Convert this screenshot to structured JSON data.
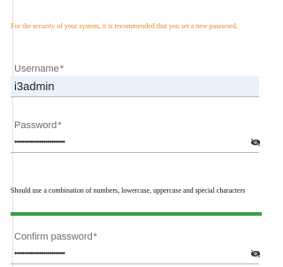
{
  "notice": "For the security of your system, it is recommended that you set a new password.",
  "fields": {
    "username": {
      "label": "Username",
      "required_mark": "*",
      "value": "i3admin"
    },
    "password": {
      "label": "Password",
      "required_mark": "*",
      "masked_value": "••••••••••••••••••••••••••",
      "toggle_icon": "eye-off-icon"
    },
    "confirm_password": {
      "label": "Confirm password",
      "required_mark": "*",
      "masked_value": "••••••••••••••••••••••••••",
      "toggle_icon": "eye-off-icon"
    }
  },
  "password_hint": "Should use a combination of numbers, lowercase, uppercase and special characters",
  "strength": {
    "level": 1.0,
    "color": "#3f9b46"
  },
  "colors": {
    "notice": "#e08a2e",
    "input_fill": "#eaf1fb"
  }
}
